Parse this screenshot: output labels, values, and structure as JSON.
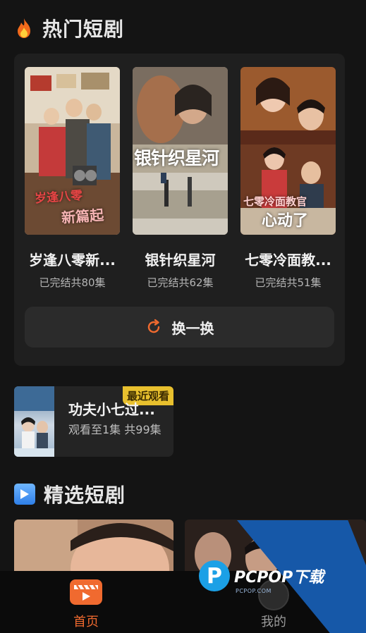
{
  "hot_section": {
    "title": "热门短剧",
    "icon": "fire-icon",
    "dramas": [
      {
        "title": "岁逢八零新...",
        "status": "已完结共80集",
        "poster_caption_1": "岁逢八零",
        "poster_caption_2": "新篇起"
      },
      {
        "title": "银针织星河",
        "status": "已完结共62集",
        "poster_caption_1": "银针织星河"
      },
      {
        "title": "七零冷面教...",
        "status": "已完结共51集",
        "poster_caption_1": "七零冷面教官",
        "poster_caption_2": "心动了"
      }
    ],
    "refresh_label": "换一换",
    "accent": "#f06a2f"
  },
  "recent": {
    "badge": "最近观看",
    "title": "功夫小七过...",
    "progress": "观看至1集 共99集",
    "badge_color": "#e8c02e"
  },
  "featured_section": {
    "title": "精选短剧",
    "icon": "play-icon"
  },
  "bottom_nav": {
    "items": [
      {
        "label": "首页",
        "icon": "clapperboard-icon",
        "active": true
      },
      {
        "label": "我的",
        "icon": "profile-icon",
        "active": false
      }
    ],
    "active_color": "#f06a2f",
    "inactive_color": "#9a9a9a"
  },
  "watermark": {
    "brand": "PCPOP下载",
    "sub": "PCPOP.COM"
  }
}
